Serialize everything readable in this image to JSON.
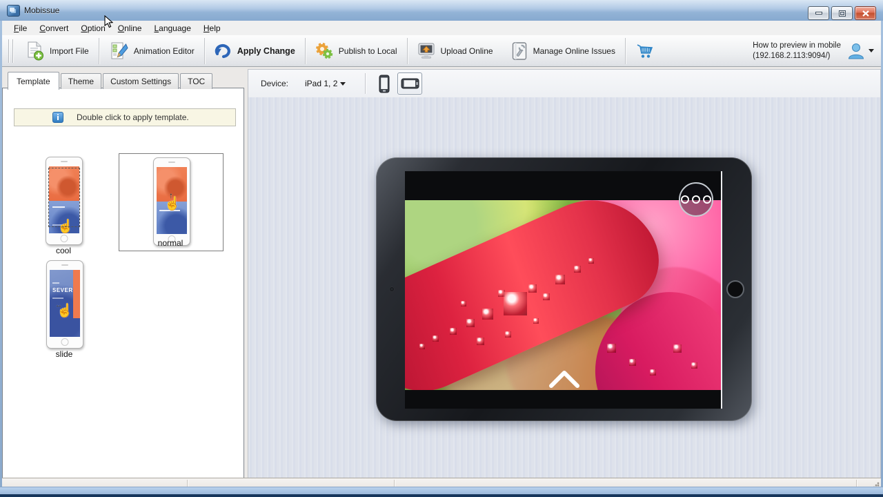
{
  "titlebar": {
    "title": "Mobissue"
  },
  "menubar": {
    "items": [
      "File",
      "Convert",
      "Option",
      "Online",
      "Language",
      "Help"
    ]
  },
  "toolbar": {
    "buttons": [
      {
        "label": "Import File"
      },
      {
        "label": "Animation Editor"
      },
      {
        "label": "Apply Change"
      },
      {
        "label": "Publish to Local"
      },
      {
        "label": "Upload Online"
      },
      {
        "label": "Manage Online Issues"
      }
    ],
    "preview_hint_line1": "How to preview in mobile",
    "preview_hint_line2": "(192.168.2.113:9094/)"
  },
  "sidebar": {
    "tabs": [
      {
        "label": "Template"
      },
      {
        "label": "Theme"
      },
      {
        "label": "Custom Settings"
      },
      {
        "label": "TOC"
      }
    ],
    "notice": "Double click to apply template.",
    "templates": [
      {
        "name": "cool"
      },
      {
        "name": "normal"
      },
      {
        "name": "slide",
        "screen_text": "SEVER"
      }
    ]
  },
  "device_bar": {
    "label": "Device:",
    "value": "iPad 1, 2"
  },
  "colors": {
    "titlebar_blue": "#9db9d9",
    "accent_blue": "#2d66b8",
    "close_red": "#c4502f",
    "notice_bg": "#f8f6e4",
    "preview_bg": "#dce1ea",
    "frame_navy": "#16365c"
  }
}
